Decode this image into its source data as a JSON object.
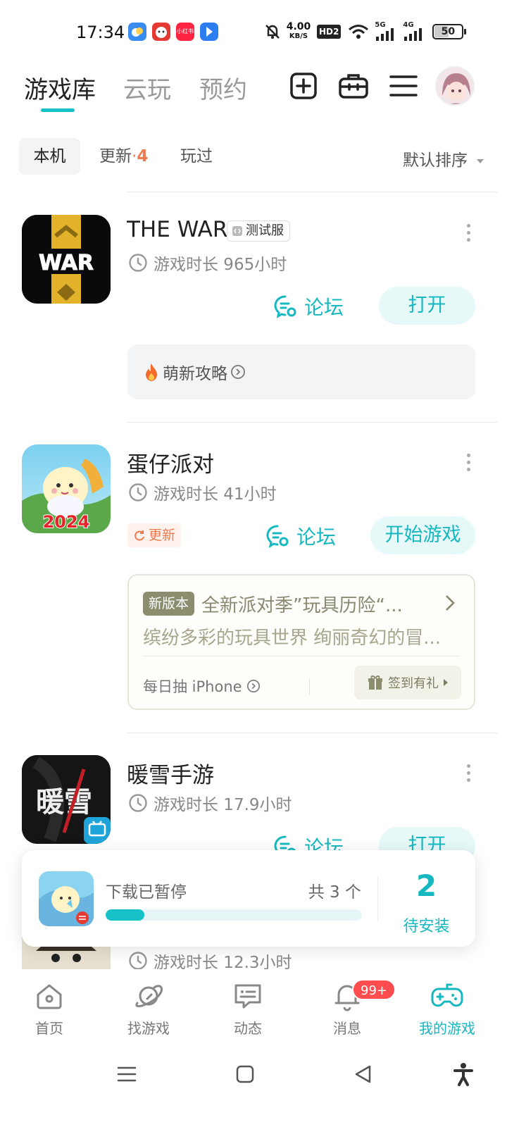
{
  "status_bar": {
    "time": "17:34",
    "net_speed_value": "4.00",
    "net_speed_unit": "KB/S",
    "hd_label": "HD2",
    "sig1_label": "5G",
    "sig2_label": "4G",
    "battery": "50",
    "icons": [
      "weather-app-icon",
      "red-app-icon",
      "xiaohongshu-app-icon",
      "blue-app-icon",
      "mute-icon",
      "wifi-icon",
      "signal-icon",
      "battery-icon"
    ],
    "app_labels": [
      "小红书"
    ]
  },
  "header": {
    "tabs": [
      {
        "label": "游戏库",
        "active": true
      },
      {
        "label": "云玩",
        "active": false
      },
      {
        "label": "预约",
        "active": false
      }
    ],
    "accent": "#16c2c8"
  },
  "filters": {
    "items": [
      {
        "label": "本机",
        "active": true
      },
      {
        "label": "更新",
        "dot": "·",
        "count": "4"
      },
      {
        "label": "玩过"
      }
    ],
    "sort_label": "默认排序"
  },
  "games": [
    {
      "title": "THE WAR",
      "badge": "测试服",
      "playtime": "游戏时长 965小时",
      "forum_label": "论坛",
      "action_label": "打开",
      "guide_label": "萌新攻略",
      "icon_text": "WAR"
    },
    {
      "title": "蛋仔派对",
      "playtime": "游戏时长 41小时",
      "update_label": "更新",
      "forum_label": "论坛",
      "action_label": "开始游戏",
      "icon_text": "2024",
      "news": {
        "tag": "新版本",
        "title": "全新派对季”玩具历险“...",
        "desc": "缤纷多彩的玩具世界 绚丽奇幻的冒...",
        "daily_label": "每日抽 iPhone",
        "gift_label": "签到有礼"
      }
    },
    {
      "title": "暖雪手游",
      "playtime": "游戏时长 17.9小时",
      "forum_label": "论坛",
      "action_label": "打开",
      "icon_text": "暖雪"
    },
    {
      "playtime": "游戏时长 12.3小时"
    }
  ],
  "download": {
    "status": "下载已暂停",
    "count": "共 3 个",
    "progress": 0.15,
    "pending_count": "2",
    "pending_label": "待安装"
  },
  "bottom_nav": [
    {
      "label": "首页",
      "icon": "home-icon"
    },
    {
      "label": "找游戏",
      "icon": "planet-icon"
    },
    {
      "label": "动态",
      "icon": "chat-icon"
    },
    {
      "label": "消息",
      "icon": "bell-icon",
      "badge": "99+"
    },
    {
      "label": "我的游戏",
      "icon": "gamepad-icon",
      "active": true
    }
  ]
}
